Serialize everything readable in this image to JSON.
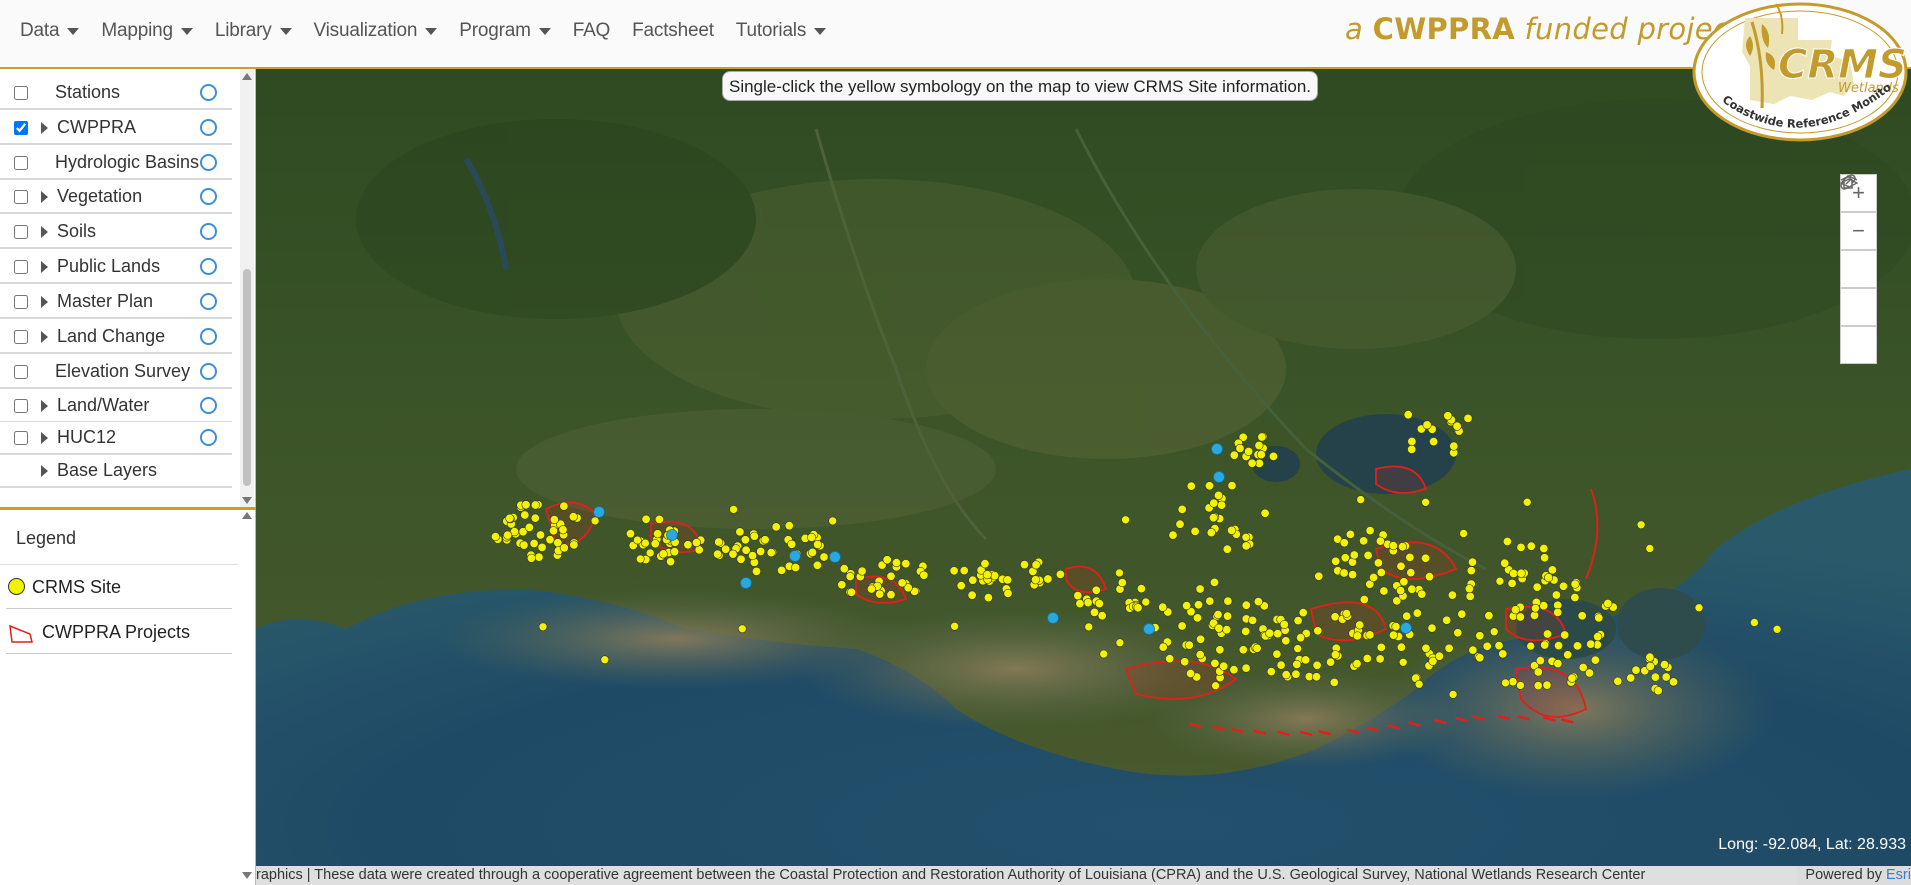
{
  "nav": {
    "items": [
      {
        "label": "Data",
        "dropdown": true
      },
      {
        "label": "Mapping",
        "dropdown": true
      },
      {
        "label": "Library",
        "dropdown": true
      },
      {
        "label": "Visualization",
        "dropdown": true
      },
      {
        "label": "Program",
        "dropdown": true
      },
      {
        "label": "FAQ",
        "dropdown": false
      },
      {
        "label": "Factsheet",
        "dropdown": false
      },
      {
        "label": "Tutorials",
        "dropdown": true
      }
    ],
    "tagline_prefix": "a",
    "tagline_brand": "CWPPRA",
    "tagline_suffix": "funded project"
  },
  "logo": {
    "main": "CRMS",
    "sub": "Wetlands",
    "ring_text": "Coastwide Reference Monitoring System",
    "accent_color": "#c39b2d"
  },
  "layers": [
    {
      "label": "Stations",
      "checked": false,
      "expandable": false
    },
    {
      "label": "CWPPRA",
      "checked": true,
      "expandable": true
    },
    {
      "label": "Hydrologic Basins",
      "checked": false,
      "expandable": false
    },
    {
      "label": "Vegetation",
      "checked": false,
      "expandable": true
    },
    {
      "label": "Soils",
      "checked": false,
      "expandable": true
    },
    {
      "label": "Public Lands",
      "checked": false,
      "expandable": true
    },
    {
      "label": "Master Plan",
      "checked": false,
      "expandable": true
    },
    {
      "label": "Land Change",
      "checked": false,
      "expandable": true
    },
    {
      "label": "Elevation Survey",
      "checked": false,
      "expandable": false
    },
    {
      "label": "Land/Water",
      "checked": false,
      "expandable": true
    },
    {
      "label": "HUC12",
      "checked": false,
      "expandable": true
    },
    {
      "label": "Base Layers",
      "checked": null,
      "expandable": true
    }
  ],
  "legend": {
    "title": "Legend",
    "items": [
      {
        "label": "CRMS Site",
        "symbol": "yellow-circle",
        "color": "#f3f300"
      },
      {
        "label": "CWPPRA Projects",
        "symbol": "red-polygon",
        "color": "#e0201a"
      }
    ]
  },
  "map": {
    "banner": "Single-click the yellow symbology on the map to view CRMS Site information.",
    "coords": "Long: -92.084, Lat: 28.933",
    "controls": [
      {
        "name": "zoom-in-button",
        "icon": "plus-icon"
      },
      {
        "name": "zoom-out-button",
        "icon": "minus-icon"
      },
      {
        "name": "home-button",
        "icon": "home-icon"
      },
      {
        "name": "share-link-button",
        "icon": "link-icon"
      },
      {
        "name": "layers-button",
        "icon": "layers-icon"
      }
    ],
    "colors": {
      "site": "#f3f300",
      "station": "#29a9e0",
      "project": "#e0201a"
    }
  },
  "attribution": {
    "text": "raphics | These data were created through a cooperative agreement between the Coastal Protection and Restoration Authority of Louisiana (CPRA) and the U.S. Geological Survey, National Wetlands Research Center",
    "powered_prefix": "Powered by",
    "powered_brand": "Esri"
  }
}
